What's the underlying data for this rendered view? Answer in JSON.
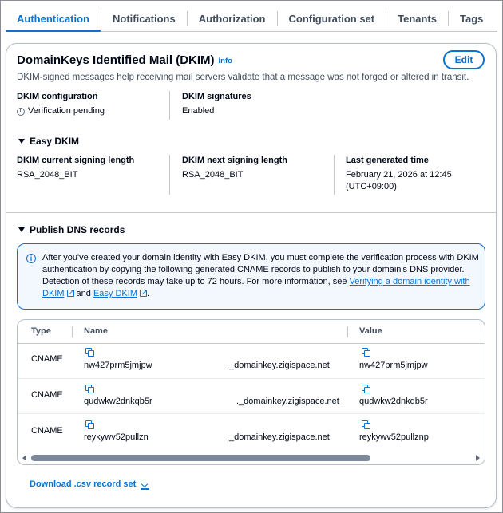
{
  "tabs": [
    {
      "label": "Authentication",
      "active": true
    },
    {
      "label": "Notifications"
    },
    {
      "label": "Authorization"
    },
    {
      "label": "Configuration set"
    },
    {
      "label": "Tenants"
    },
    {
      "label": "Tags"
    }
  ],
  "dkim": {
    "title": "DomainKeys Identified Mail (DKIM)",
    "info_label": "Info",
    "edit_label": "Edit",
    "description": "DKIM-signed messages help receiving mail servers validate that a message was not forged or altered in transit.",
    "config_label": "DKIM configuration",
    "config_value": "Verification pending",
    "signatures_label": "DKIM signatures",
    "signatures_value": "Enabled"
  },
  "easy_dkim": {
    "heading": "Easy DKIM",
    "current_length_label": "DKIM current signing length",
    "current_length_value": "RSA_2048_BIT",
    "next_length_label": "DKIM next signing length",
    "next_length_value": "RSA_2048_BIT",
    "last_generated_label": "Last generated time",
    "last_generated_value_line1": "February 21, 2026 at 12:45",
    "last_generated_value_line2": "(UTC+09:00)"
  },
  "publish_dns": {
    "heading": "Publish DNS records",
    "alert_text_1": "After you've created your domain identity with Easy DKIM, you must complete the verification process with DKIM authentication by copying the following generated CNAME records to publish to your domain's DNS provider. Detection of these records may take up to 72 hours. For more information, see ",
    "alert_link_1": "Verifying a domain identity with DKIM",
    "alert_text_2": " and ",
    "alert_link_2": "Easy DKIM",
    "alert_text_3": ".",
    "table": {
      "columns": [
        "Type",
        "Name",
        "Value"
      ],
      "rows": [
        {
          "type": "CNAME",
          "name_prefix": "nw427prm5jmjpw",
          "name_suffix": "._domainkey.zigispace.net",
          "value_prefix": "nw427prm5jmjpw"
        },
        {
          "type": "CNAME",
          "name_prefix": "qudwkw2dnkqb5r",
          "name_suffix": "._domainkey.zigispace.net",
          "value_prefix": "qudwkw2dnkqb5r"
        },
        {
          "type": "CNAME",
          "name_prefix": "reykywv52pullzn",
          "name_suffix": "._domainkey.zigispace.net",
          "value_prefix": "reykywv52pullznp"
        }
      ]
    },
    "download_label": "Download .csv record set"
  }
}
